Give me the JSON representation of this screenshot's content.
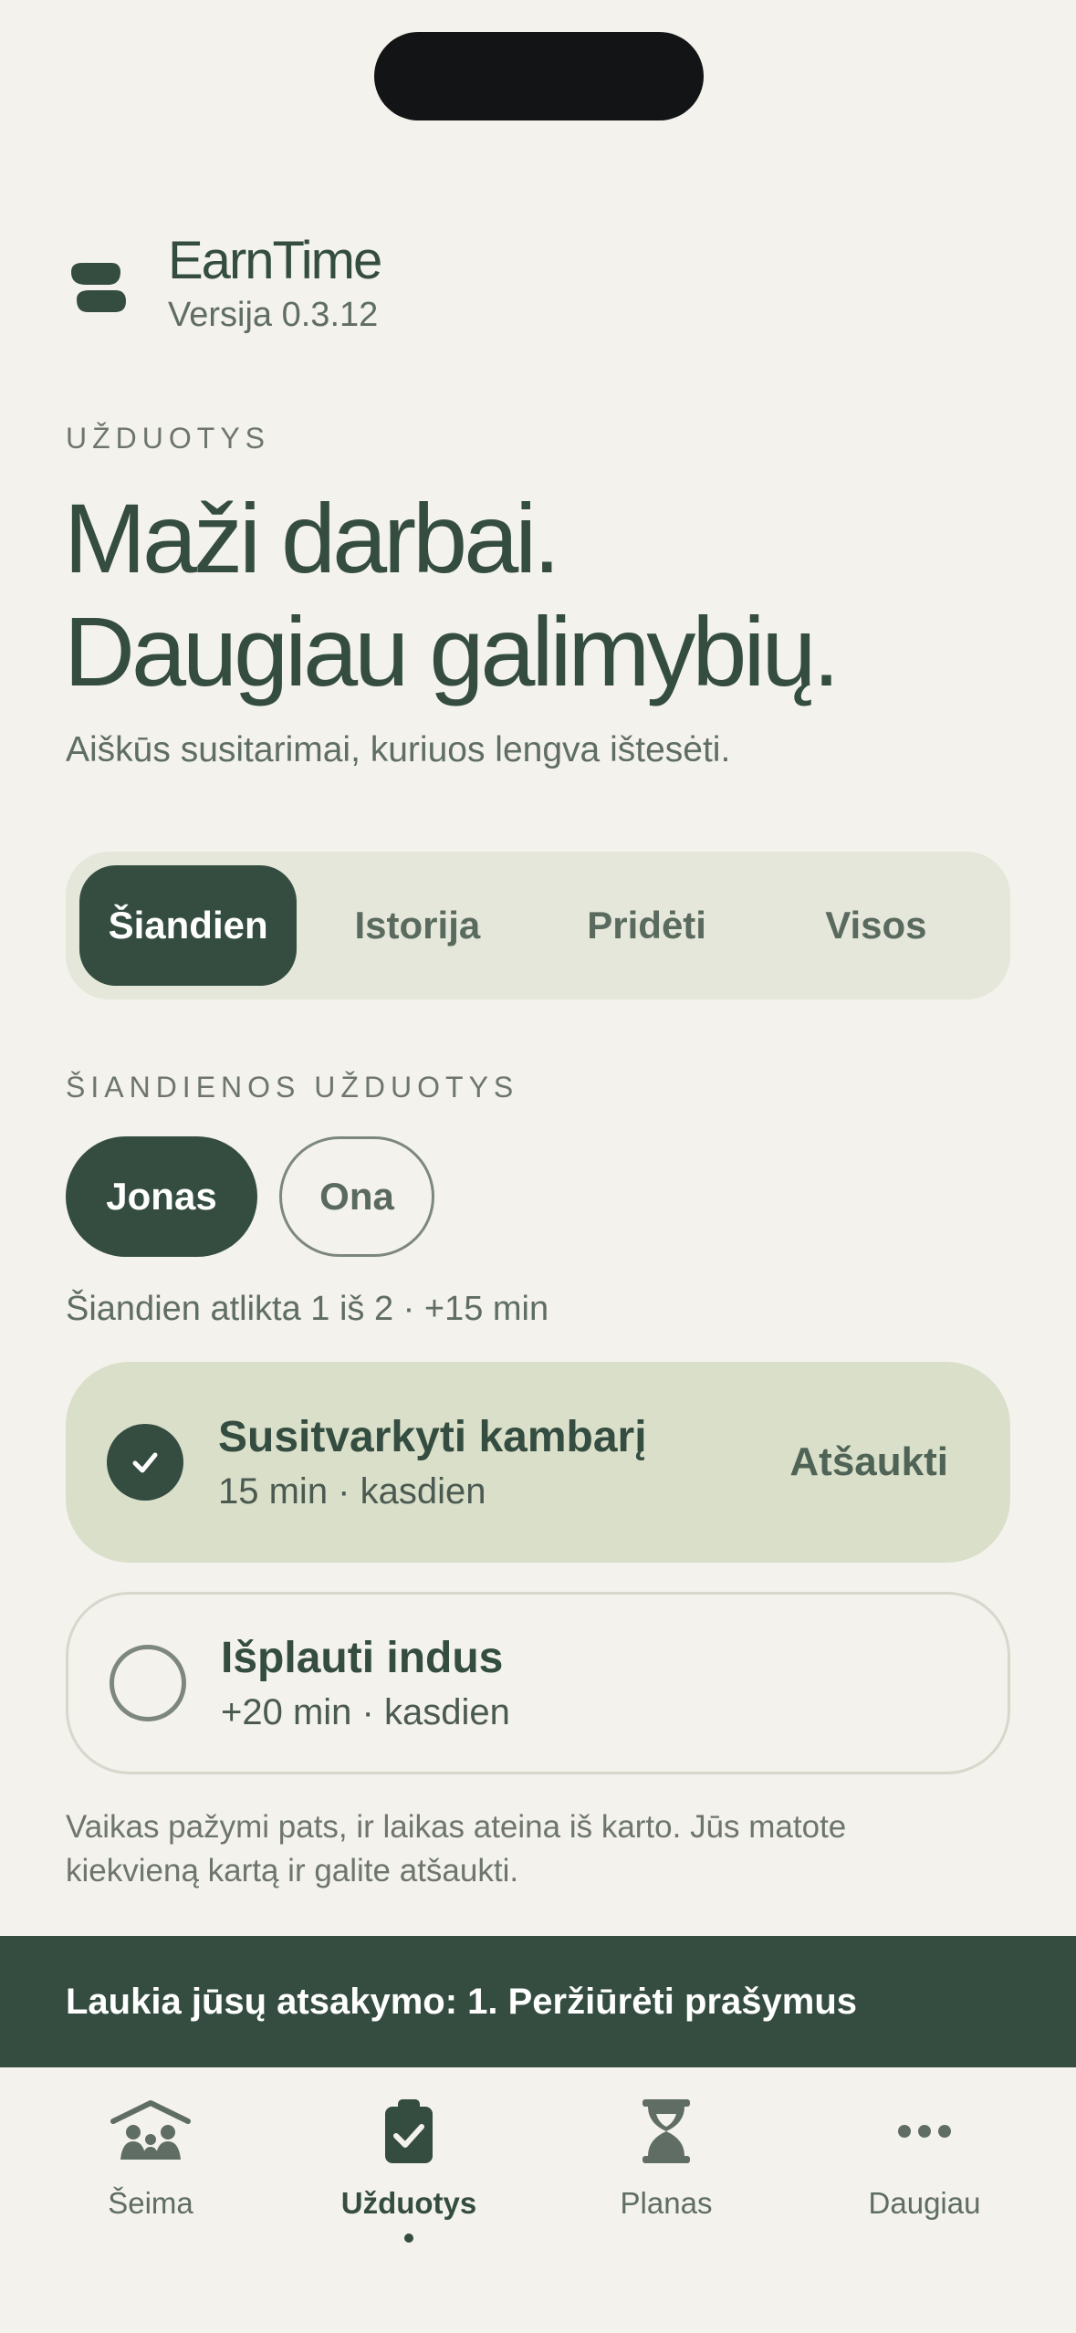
{
  "app": {
    "name": "EarnTime",
    "version": "Versija 0.3.12"
  },
  "section": {
    "eyebrow": "UŽDUOTYS"
  },
  "hero": {
    "line1": "Maži darbai.",
    "line2": "Daugiau galimybių.",
    "subtitle": "Aiškūs susitarimai, kuriuos lengva ištesėti."
  },
  "segments": [
    {
      "label": "Šiandien",
      "active": true
    },
    {
      "label": "Istorija",
      "active": false
    },
    {
      "label": "Pridėti",
      "active": false
    },
    {
      "label": "Visos",
      "active": false
    }
  ],
  "today": {
    "heading": "ŠIANDIENOS UŽDUOTYS",
    "children": [
      {
        "name": "Jonas",
        "active": true
      },
      {
        "name": "Ona",
        "active": false
      }
    ],
    "progress": "Šiandien atlikta 1 iš 2 · +15 min",
    "tasks": [
      {
        "title": "Susitvarkyti kambarį",
        "meta": "15 min · kasdien",
        "done": true,
        "action": "Atšaukti"
      },
      {
        "title": "Išplauti indus",
        "meta": "+20 min · kasdien",
        "done": false
      }
    ],
    "note": "Vaikas pažymi pats, ir laikas ateina iš karto. Jūs matote kiekvieną kartą ir galite atšaukti."
  },
  "banner": {
    "text": "Laukia jūsų atsakymo: 1. Peržiūrėti prašymus"
  },
  "tabbar": [
    {
      "label": "Šeima",
      "icon": "family-icon",
      "active": false
    },
    {
      "label": "Užduotys",
      "icon": "clipboard-check-icon",
      "active": true
    },
    {
      "label": "Planas",
      "icon": "hourglass-icon",
      "active": false
    },
    {
      "label": "Daugiau",
      "icon": "more-dots-icon",
      "active": false
    }
  ],
  "colors": {
    "primary": "#344d40",
    "background": "#f3f2ec",
    "done_card": "#dadfca",
    "segment_bg": "#e5e7db"
  }
}
